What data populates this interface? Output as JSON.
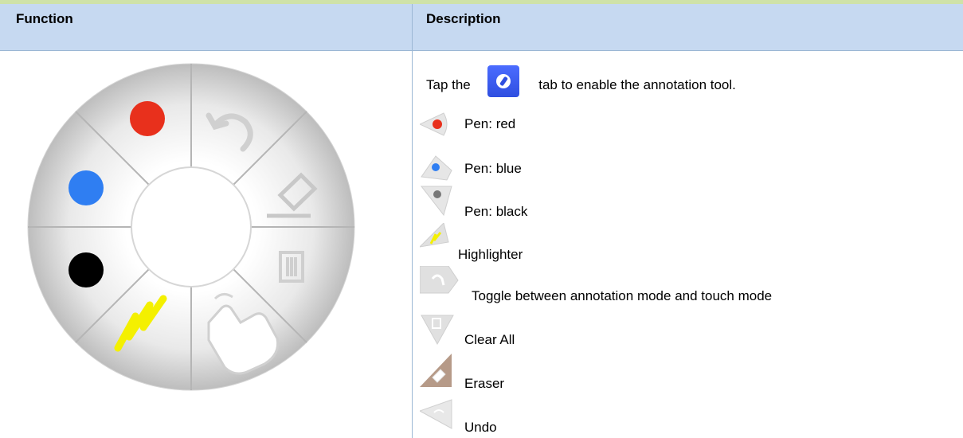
{
  "header": {
    "col1": "Function",
    "col2": "Description"
  },
  "description": {
    "tap_prefix": "Tap the",
    "tap_suffix": "tab to enable the annotation tool.",
    "items": [
      {
        "label": "Pen: red",
        "icon": "red-pen-icon"
      },
      {
        "label": "Pen: blue",
        "icon": "blue-pen-icon"
      },
      {
        "label": "Pen: black",
        "icon": "black-pen-icon"
      },
      {
        "label": "Highlighter",
        "icon": "highlighter-icon"
      },
      {
        "label": "Toggle between annotation mode and touch mode",
        "icon": "touch-mode-icon"
      },
      {
        "label": "Clear All",
        "icon": "clear-all-icon"
      },
      {
        "label": "Eraser",
        "icon": "eraser-icon"
      },
      {
        "label": "Undo",
        "icon": "undo-icon"
      }
    ]
  },
  "colors": {
    "header_bg": "#c6d9f1",
    "border": "#9bb7d4",
    "red": "#e8301c",
    "blue": "#2f7ef2",
    "black": "#000000",
    "highlighter": "#f4f000",
    "tab_icon": "#3a5cf0"
  }
}
